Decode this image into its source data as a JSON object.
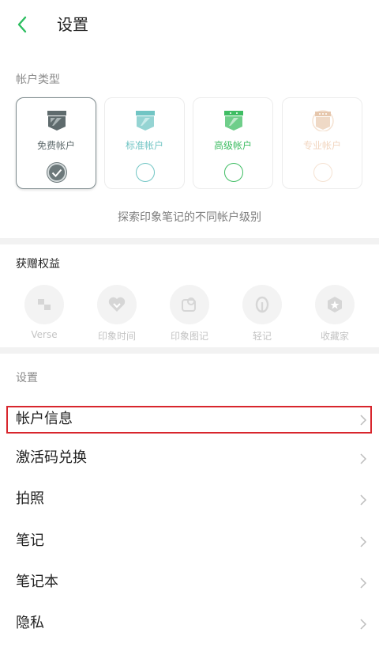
{
  "header": {
    "title": "设置"
  },
  "account_type": {
    "label": "帐户类型",
    "cards": [
      {
        "label": "免费帐户",
        "color": "#5f6b6d",
        "selected": true
      },
      {
        "label": "标准帐户",
        "color": "#71c5c4",
        "selected": false
      },
      {
        "label": "高级帐户",
        "color": "#3fbd63",
        "selected": false
      },
      {
        "label": "专业帐户",
        "color": "#f2d6c0",
        "selected": false
      }
    ],
    "explore_text": "探索印象笔记的不同帐户级别"
  },
  "gifts": {
    "title": "获赠权益",
    "items": [
      {
        "label": "Verse",
        "icon": "verse-icon"
      },
      {
        "label": "印象时间",
        "icon": "heart-icon"
      },
      {
        "label": "印象图记",
        "icon": "image-note-icon"
      },
      {
        "label": "轻记",
        "icon": "light-note-icon"
      },
      {
        "label": "收藏家",
        "icon": "collector-icon"
      }
    ]
  },
  "settings": {
    "label": "设置",
    "rows": [
      {
        "label": "帐户信息"
      },
      {
        "label": "激活码兑换"
      },
      {
        "label": "拍照"
      },
      {
        "label": "笔记"
      },
      {
        "label": "笔记本"
      },
      {
        "label": "隐私"
      }
    ]
  },
  "colors": {
    "accent": "#2dbe60",
    "highlight": "#d8262d"
  }
}
